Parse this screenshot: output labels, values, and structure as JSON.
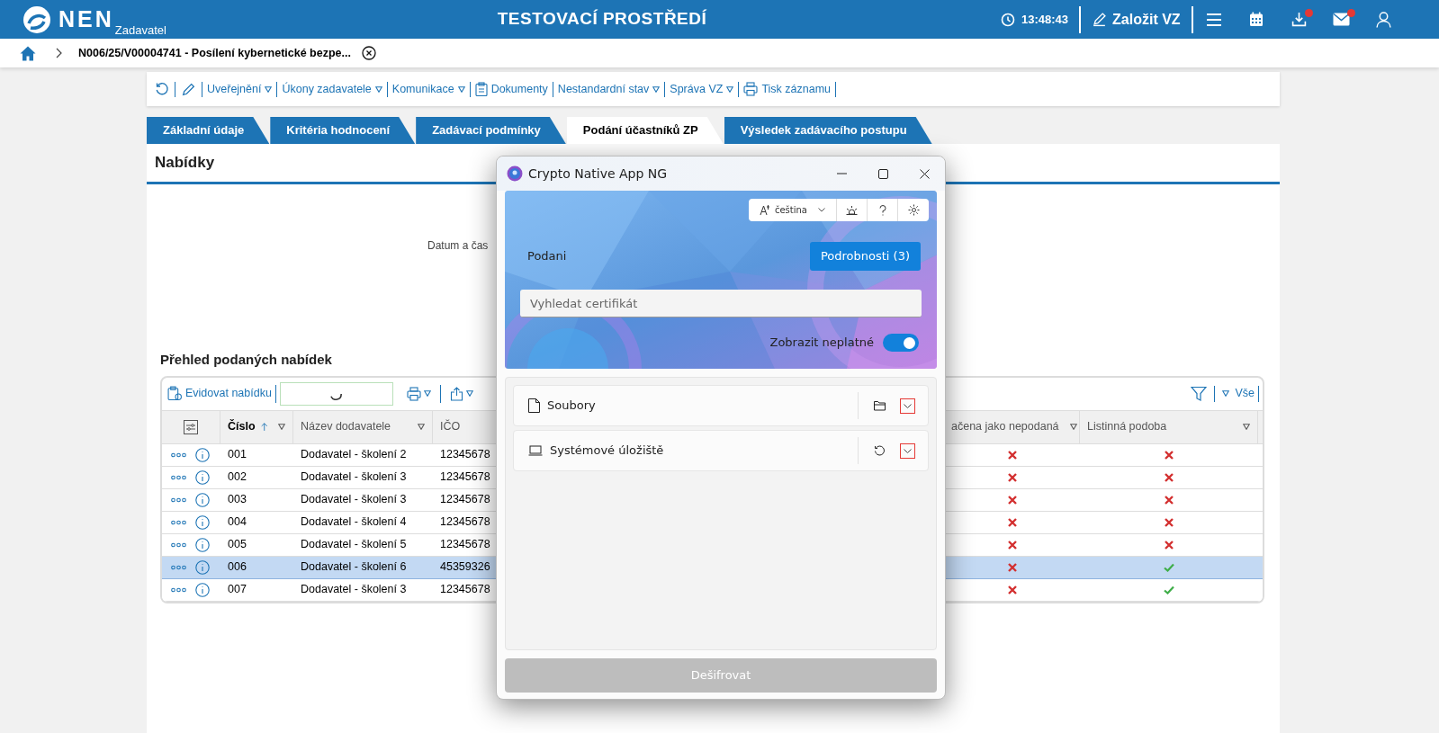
{
  "header": {
    "logo": "NEN",
    "role": "Zadavatel",
    "title": "TESTOVACÍ PROSTŘEDÍ",
    "time": "13:48:43",
    "create_button": "Založit VZ",
    "icons": [
      {
        "kind": "menu",
        "badge": false
      },
      {
        "kind": "calendar",
        "badge": false
      },
      {
        "kind": "download",
        "badge": true
      },
      {
        "kind": "mail",
        "badge": true
      },
      {
        "kind": "user",
        "badge": false
      }
    ]
  },
  "breadcrumb": {
    "text": "N006/25/V00004741 - Posílení kybernetické bezpe..."
  },
  "toolbar": [
    {
      "kind": "refresh"
    },
    {
      "kind": "edit"
    },
    {
      "kind": "menu",
      "label": "Uveřejnění",
      "dropdown": true
    },
    {
      "kind": "menu",
      "label": "Úkony zadavatele",
      "dropdown": true
    },
    {
      "kind": "menu",
      "label": "Komunikace",
      "dropdown": true
    },
    {
      "kind": "documents",
      "label": "Dokumenty",
      "dropdown": false
    },
    {
      "kind": "menu",
      "label": "Nestandardní stav",
      "dropdown": true
    },
    {
      "kind": "menu",
      "label": "Správa VZ",
      "dropdown": true
    },
    {
      "kind": "print",
      "label": "Tisk záznamu",
      "dropdown": false
    }
  ],
  "tabs": [
    {
      "label": "Základní údaje",
      "selected": false
    },
    {
      "label": "Kritéria hodnocení",
      "selected": false
    },
    {
      "label": "Zadávací podmínky",
      "selected": false
    },
    {
      "label": "Podání účastníků ZP",
      "selected": true
    },
    {
      "label": "Výsledek zadávacího postupu",
      "selected": false
    }
  ],
  "section_title": "Nabídky",
  "date_label": "Datum a čas",
  "table_title": "Přehled podaných nabídek",
  "table": {
    "register_button": "Evidovat nabídku",
    "all_filter": "Vše",
    "columns": [
      {
        "label": "Číslo",
        "sorted": true
      },
      {
        "label": "Název dodavatele",
        "sorted": false
      },
      {
        "label": "IČO",
        "sorted": false
      },
      {
        "label": "ačena jako nepodaná",
        "sorted": false
      },
      {
        "label": "Listinná podoba",
        "sorted": false
      }
    ],
    "rows": [
      {
        "cislo": "001",
        "nazev": "Dodavatel - školení 2",
        "ico": "12345678",
        "nepodana": false,
        "listinna": false,
        "selected": false
      },
      {
        "cislo": "002",
        "nazev": "Dodavatel - školení 3",
        "ico": "12345678",
        "nepodana": false,
        "listinna": false,
        "selected": false
      },
      {
        "cislo": "003",
        "nazev": "Dodavatel - školení 3",
        "ico": "12345678",
        "nepodana": false,
        "listinna": false,
        "selected": false
      },
      {
        "cislo": "004",
        "nazev": "Dodavatel - školení 4",
        "ico": "12345678",
        "nepodana": false,
        "listinna": false,
        "selected": false
      },
      {
        "cislo": "005",
        "nazev": "Dodavatel - školení 5",
        "ico": "12345678",
        "nepodana": false,
        "listinna": false,
        "selected": false
      },
      {
        "cislo": "006",
        "nazev": "Dodavatel - školení 6",
        "ico": "45359326",
        "nepodana": false,
        "listinna": true,
        "selected": true
      },
      {
        "cislo": "007",
        "nazev": "Dodavatel - školení 3",
        "ico": "12345678",
        "nepodana": false,
        "listinna": true,
        "selected": false
      }
    ]
  },
  "dialog": {
    "title": "Crypto Native App NG",
    "language": "čeština",
    "user": "Podani",
    "details_button": "Podrobnosti (3)",
    "search": {
      "placeholder": "Vyhledat certifikát"
    },
    "toggle": {
      "label": "Zobrazit neplatné",
      "on": true
    },
    "sections": [
      {
        "kind": "files",
        "label": "Soubory"
      },
      {
        "kind": "storage",
        "label": "Systémové úložiště"
      }
    ],
    "decrypt_button": {
      "label": "Dešifrovat",
      "disabled": true
    }
  }
}
